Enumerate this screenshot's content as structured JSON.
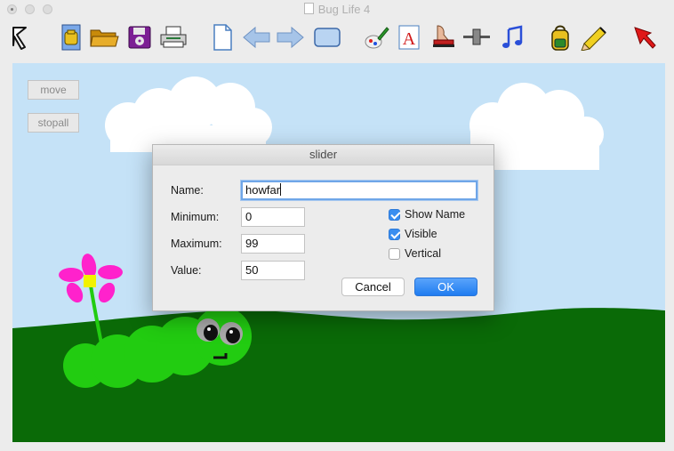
{
  "window": {
    "title": "Bug Life 4"
  },
  "toolbar": {
    "tools": [
      {
        "name": "pointer-icon"
      },
      {
        "name": "new-project-icon"
      },
      {
        "name": "open-folder-icon"
      },
      {
        "name": "save-disk-icon"
      },
      {
        "name": "print-icon"
      },
      {
        "name": "new-page-icon"
      },
      {
        "name": "prev-page-icon"
      },
      {
        "name": "next-page-icon"
      },
      {
        "name": "new-textbox-icon"
      },
      {
        "name": "paint-icon"
      },
      {
        "name": "text-icon"
      },
      {
        "name": "stamp-icon"
      },
      {
        "name": "slider-icon"
      },
      {
        "name": "music-note-icon"
      },
      {
        "name": "backpack-icon"
      },
      {
        "name": "pencil-icon"
      },
      {
        "name": "red-arrow-icon"
      }
    ]
  },
  "canvas": {
    "buttons": {
      "move": "move",
      "stopall": "stopall"
    }
  },
  "dialog": {
    "title": "slider",
    "name_label": "Name:",
    "name_value": "howfar",
    "min_label": "Minimum:",
    "min_value": "0",
    "max_label": "Maximum:",
    "max_value": "99",
    "value_label": "Value:",
    "value_value": "50",
    "show_name": {
      "label": "Show Name",
      "checked": true
    },
    "visible": {
      "label": "Visible",
      "checked": true
    },
    "vertical": {
      "label": "Vertical",
      "checked": false
    },
    "cancel": "Cancel",
    "ok": "OK"
  },
  "colors": {
    "sky": "#c5e2f7",
    "grass": "#0a6a07",
    "bug_body": "#22cc11",
    "accent": "#2a7cf0"
  }
}
